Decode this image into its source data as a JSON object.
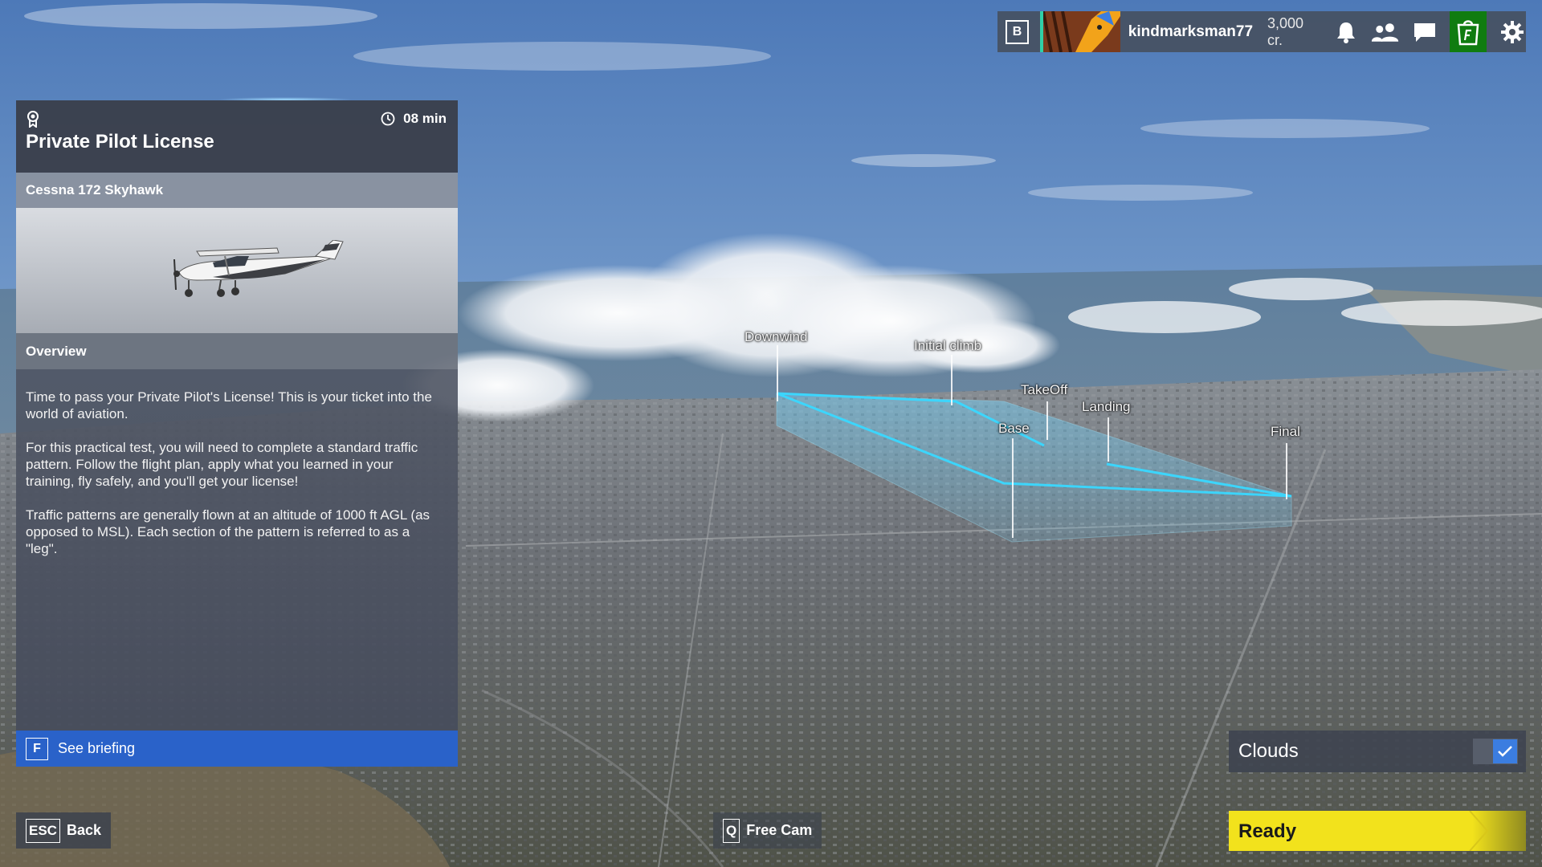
{
  "top_bar": {
    "profile_key": "B",
    "username": "kindmarksman77",
    "credits": "3,000 cr.",
    "icons": [
      "bell-icon",
      "friends-icon",
      "chat-icon",
      "marketplace-icon",
      "gear-icon"
    ],
    "accent_color": "#2fd0a8",
    "store_color": "#107c10"
  },
  "panel": {
    "icon": "award-icon",
    "title": "Private Pilot License",
    "duration": "08 min",
    "aircraft": "Cessna 172 Skyhawk",
    "overview_label": "Overview",
    "description": [
      "Time to pass your Private Pilot's License! This is your ticket into the world of aviation.",
      "For this practical test, you will need to complete a standard traffic pattern. Follow the flight plan, apply what you learned in your training, fly safely, and you'll get your license!",
      "Traffic patterns are generally flown at an altitude of 1000 ft AGL (as opposed to MSL). Each section of the pattern is referred to as a \"leg\"."
    ],
    "briefing_key": "F",
    "briefing_label": "See briefing",
    "briefing_color": "#2a62c9"
  },
  "waypoints": {
    "downwind": "Downwind",
    "initial_climb": "Initial climb",
    "takeoff": "TakeOff",
    "landing": "Landing",
    "base": "Base",
    "final": "Final",
    "route_color": "#39d8ff"
  },
  "controls": {
    "back_key": "ESC",
    "back_label": "Back",
    "freecam_key": "Q",
    "freecam_label": "Free Cam",
    "clouds_label": "Clouds",
    "clouds_checked": true,
    "ready_label": "Ready",
    "ready_color": "#f2e21c"
  }
}
